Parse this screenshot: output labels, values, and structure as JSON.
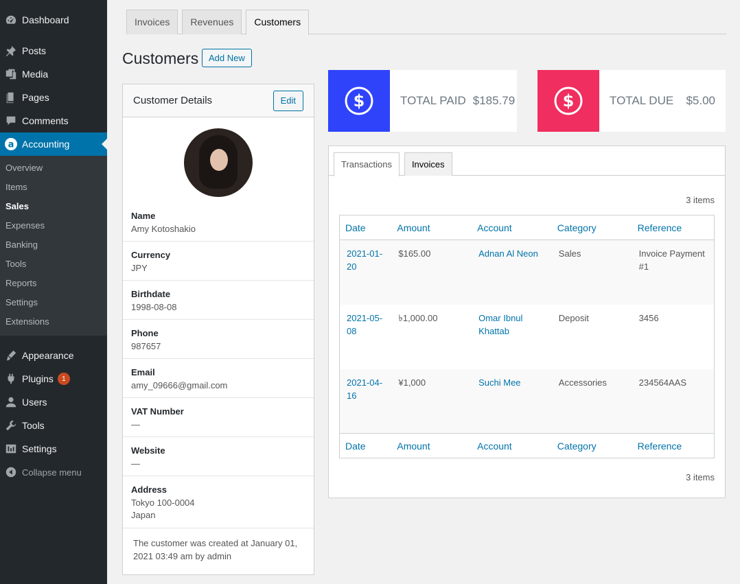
{
  "sidebar": {
    "top_items": [
      {
        "label": "Dashboard",
        "icon": "dashboard-icon"
      },
      {
        "label": "Posts",
        "icon": "pin-icon"
      },
      {
        "label": "Media",
        "icon": "media-icon"
      },
      {
        "label": "Pages",
        "icon": "pages-icon"
      },
      {
        "label": "Comments",
        "icon": "comment-icon"
      },
      {
        "label": "Accounting",
        "icon": "accounting-icon"
      }
    ],
    "submenu": [
      "Overview",
      "Items",
      "Sales",
      "Expenses",
      "Banking",
      "Tools",
      "Reports",
      "Settings",
      "Extensions"
    ],
    "current_submenu": "Sales",
    "bottom_items": [
      {
        "label": "Appearance",
        "icon": "brush-icon"
      },
      {
        "label": "Plugins",
        "icon": "plugin-icon",
        "badge": "1"
      },
      {
        "label": "Users",
        "icon": "user-icon"
      },
      {
        "label": "Tools",
        "icon": "wrench-icon"
      },
      {
        "label": "Settings",
        "icon": "settings-icon"
      }
    ],
    "collapse_label": "Collapse menu"
  },
  "top_tabs": [
    "Invoices",
    "Revenues",
    "Customers"
  ],
  "active_top_tab": "Customers",
  "page": {
    "title": "Customers",
    "add_new": "Add New"
  },
  "customer_card": {
    "title": "Customer Details",
    "edit_label": "Edit",
    "fields": [
      {
        "label": "Name",
        "value": "Amy Kotoshakio"
      },
      {
        "label": "Currency",
        "value": "JPY"
      },
      {
        "label": "Birthdate",
        "value": "1998-08-08"
      },
      {
        "label": "Phone",
        "value": "987657"
      },
      {
        "label": "Email",
        "value": "amy_09666@gmail.com"
      },
      {
        "label": "VAT Number",
        "value": "—"
      },
      {
        "label": "Website",
        "value": "—"
      }
    ],
    "address": {
      "label": "Address",
      "line1": "Tokyo 100-0004",
      "line2": "Japan"
    },
    "created_note": "The customer was created at January 01, 2021 03:49 am by admin"
  },
  "stats": {
    "paid": {
      "label": "TOTAL PAID",
      "amount": "$185.79",
      "color": "#2f43fb"
    },
    "due": {
      "label": "TOTAL DUE",
      "amount": "$5.00",
      "color": "#f02e5f"
    }
  },
  "transactions": {
    "tabs": [
      "Transactions",
      "Invoices"
    ],
    "active_tab": "Transactions",
    "items_count": "3 items",
    "columns": [
      "Date",
      "Amount",
      "Account",
      "Category",
      "Reference"
    ],
    "rows": [
      {
        "date": "2021-01-20",
        "amount": "$165.00",
        "account": "Adnan Al Neon",
        "category": "Sales",
        "reference": "Invoice Payment #1"
      },
      {
        "date": "2021-05-08",
        "amount": "৳1,000.00",
        "account": "Omar Ibnul Khattab",
        "category": "Deposit",
        "reference": "3456"
      },
      {
        "date": "2021-04-16",
        "amount": "¥1,000",
        "account": "Suchi Mee",
        "category": "Accessories",
        "reference": "234564AAS"
      }
    ]
  }
}
